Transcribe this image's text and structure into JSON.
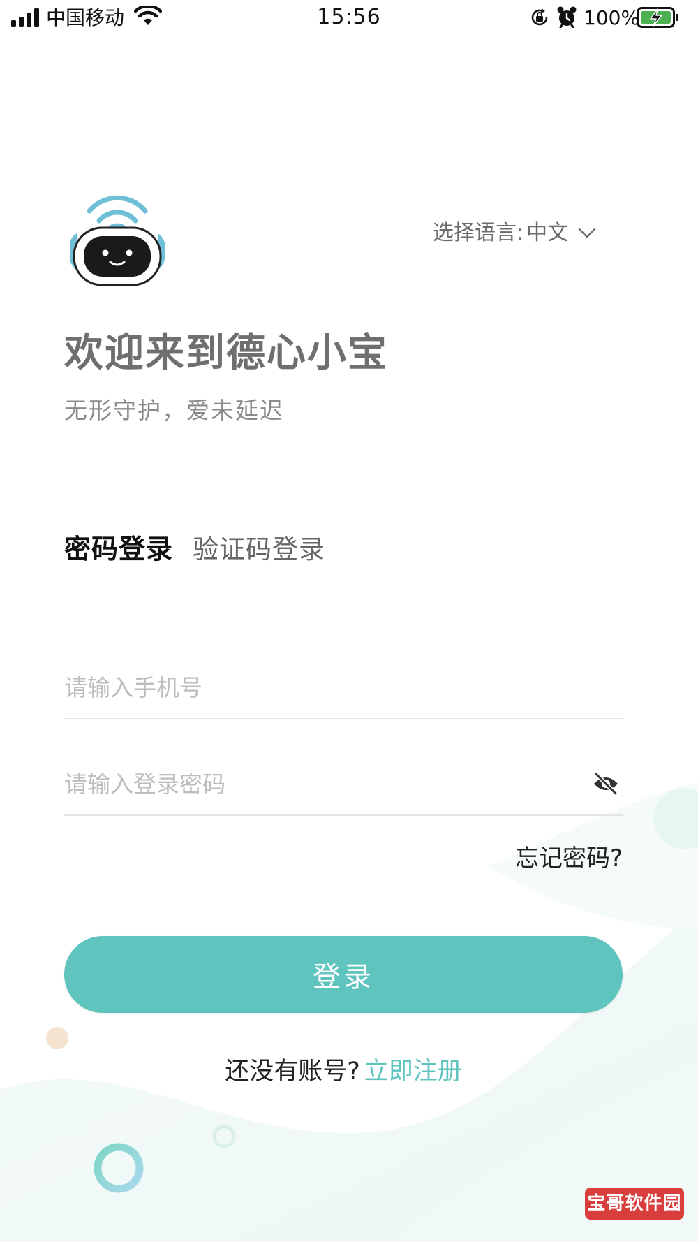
{
  "status_bar": {
    "carrier": "中国移动",
    "time": "15:56",
    "battery_percent": "100%",
    "icons": [
      "signal-icon",
      "wifi-icon",
      "lock-rotation-icon",
      "alarm-icon",
      "battery-charging-icon"
    ]
  },
  "header": {
    "logo": "robot-logo",
    "language_label": "选择语言:",
    "language_value": "中文"
  },
  "welcome": {
    "title": "欢迎来到德心小宝",
    "subtitle": "无形守护，爱未延迟"
  },
  "tabs": {
    "password_login": "密码登录",
    "code_login": "验证码登录",
    "active": "password_login"
  },
  "form": {
    "phone_placeholder": "请输入手机号",
    "phone_value": "",
    "password_placeholder": "请输入登录密码",
    "password_value": "",
    "forgot_password": "忘记密码?"
  },
  "actions": {
    "login_label": "登录",
    "register_prompt": "还没有账号?",
    "register_link": "立即注册"
  },
  "watermark": "宝哥软件园",
  "colors": {
    "accent": "#5fc4be",
    "text_primary": "#222222",
    "text_secondary": "#6f6f6f",
    "placeholder": "#bdbdbd",
    "watermark_bg": "#d83e3b"
  }
}
